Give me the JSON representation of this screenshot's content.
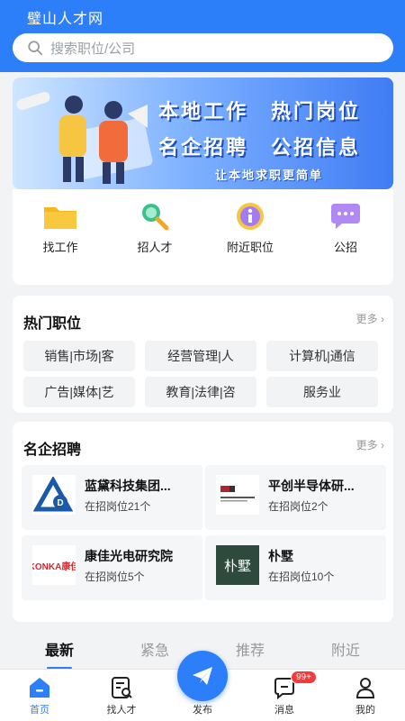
{
  "header": {
    "title": "璧山人才网",
    "search_placeholder": "搜索职位/公司",
    "bg_color": "#2d7ff9"
  },
  "banner": {
    "line1": "本地工作　热门岗位",
    "line2": "名企招聘　公招信息",
    "line3": "让本地求职更简单"
  },
  "quick_nav": [
    {
      "label": "找工作",
      "icon": "folder-icon"
    },
    {
      "label": "招人才",
      "icon": "magnifier-icon"
    },
    {
      "label": "附近职位",
      "icon": "info-icon"
    },
    {
      "label": "公招",
      "icon": "chat-bubble-icon"
    }
  ],
  "hot_jobs": {
    "title": "热门职位",
    "more": "更多",
    "tags": [
      "销售|市场|客",
      "经营管理|人",
      "计算机|通信",
      "广告|媒体|艺",
      "教育|法律|咨",
      "服务业"
    ]
  },
  "famous_companies": {
    "title": "名企招聘",
    "more": "更多",
    "items": [
      {
        "name": "蓝黛科技集团...",
        "jobs": "在招岗位21个",
        "logo": "landai-logo"
      },
      {
        "name": "平创半导体研...",
        "jobs": "在招岗位2个",
        "logo": "pingchuang-logo"
      },
      {
        "name": "康佳光电研究院",
        "jobs": "在招岗位5个",
        "logo": "konka-logo",
        "logo_text": "KONKA康佳"
      },
      {
        "name": "朴墅",
        "jobs": "在招岗位10个",
        "logo": "pushu-logo",
        "logo_text": "朴墅"
      }
    ]
  },
  "feed_tabs": [
    "最新",
    "紧急",
    "推荐",
    "附近"
  ],
  "bottom_nav": {
    "items": [
      "首页",
      "找人才",
      "发布",
      "消息",
      "我的"
    ],
    "message_badge": "99+",
    "accent_color": "#2d7ff9"
  }
}
